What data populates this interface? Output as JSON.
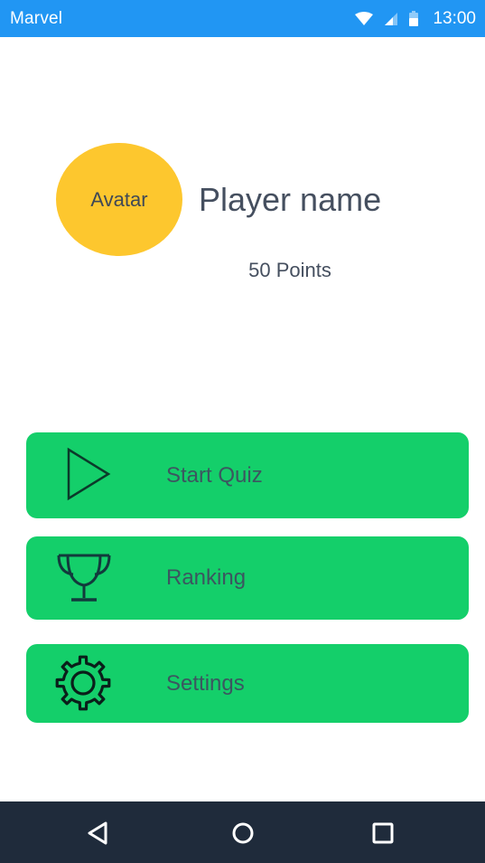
{
  "status_bar": {
    "app_name": "Marvel",
    "time": "13:00",
    "icons": [
      "wifi-icon",
      "signal-icon",
      "battery-icon"
    ],
    "color": "#2196f3"
  },
  "profile": {
    "avatar_label": "Avatar",
    "player_name": "Player name",
    "points": "50 Points",
    "avatar_color": "#fdc72e"
  },
  "menu": {
    "accent_color": "#14cf6a",
    "items": [
      {
        "label": "Start Quiz",
        "icon": "play-icon"
      },
      {
        "label": "Ranking",
        "icon": "trophy-icon"
      },
      {
        "label": "Settings",
        "icon": "gear-icon"
      }
    ]
  },
  "nav_bar": {
    "buttons": [
      "back-icon",
      "home-icon",
      "recents-icon"
    ],
    "color": "#1f2b3b"
  }
}
